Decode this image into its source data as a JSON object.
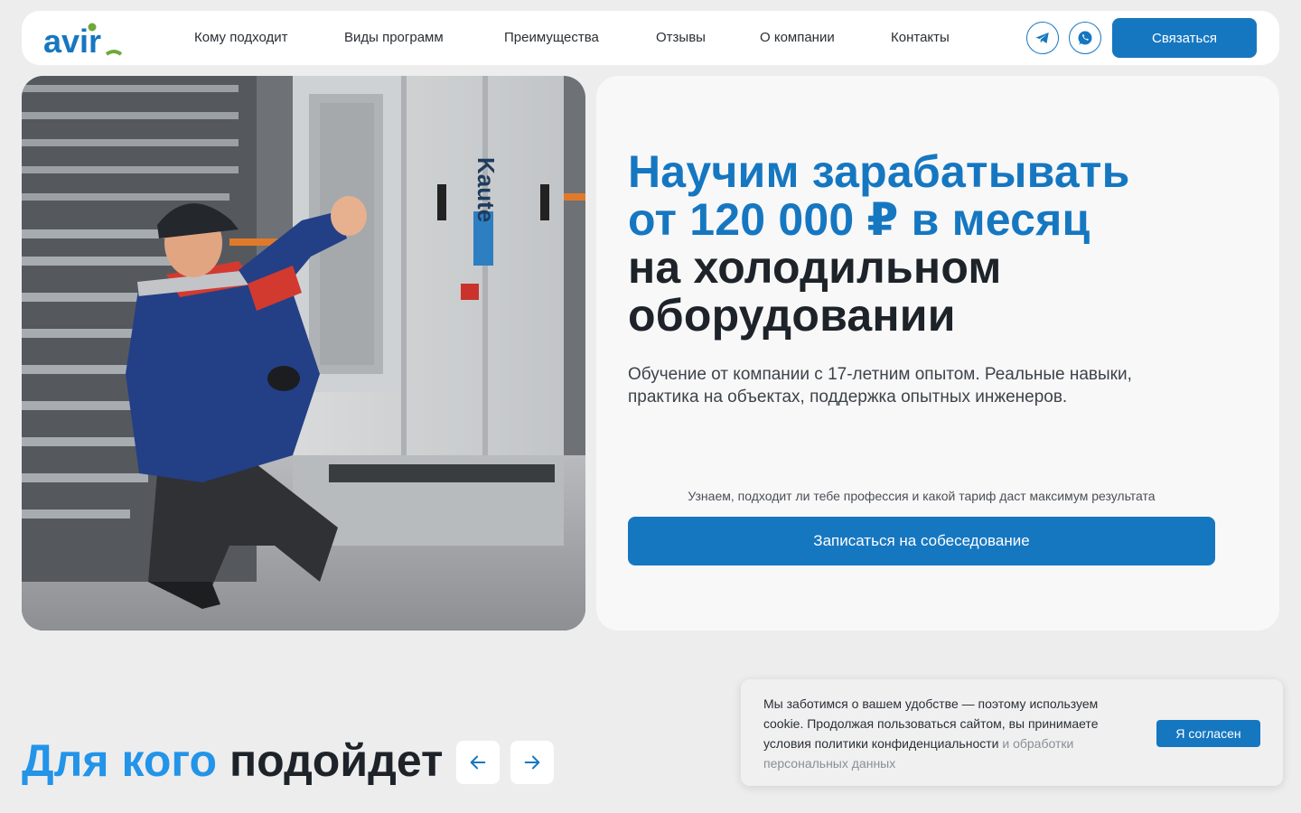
{
  "header": {
    "logo_text": "avir",
    "nav": [
      {
        "label": "Кому подходит"
      },
      {
        "label": "Виды программ"
      },
      {
        "label": "Преимущества"
      },
      {
        "label": "Отзывы"
      },
      {
        "label": "О компании"
      },
      {
        "label": "Контакты"
      }
    ],
    "social_icons": [
      "telegram-icon",
      "whatsapp-icon"
    ],
    "cta_label": "Связаться"
  },
  "hero": {
    "title_blue_1": "Научим зарабатывать",
    "title_blue_2": "от 120 000 ₽ в месяц",
    "title_dark_1": "на холодильном",
    "title_dark_2": "оборудовании",
    "subtitle": "Обучение от компании с 17-летним опытом. Реальные навыки, практика на объектах, поддержка опытных инженеров.",
    "note": "Узнаем, подходит ли тебе профессия и какой тариф даст максимум результата",
    "button_label": "Записаться на собеседование",
    "photo_brand_text": "Kaute"
  },
  "section": {
    "title_blue": "Для кого",
    "title_dark": "подойдет"
  },
  "cookie": {
    "text_main": "Мы заботимся о вашем удобстве — поэтому используем cookie. Продолжая пользоваться сайтом, вы принимаете условия политики конфиденциальности",
    "text_muted": " и обработки персональных данных",
    "accept_label": "Я согласен"
  },
  "colors": {
    "accent": "#1677c1",
    "section_accent": "#2394e8",
    "logo_green": "#6fa83a",
    "background": "#ededee"
  }
}
